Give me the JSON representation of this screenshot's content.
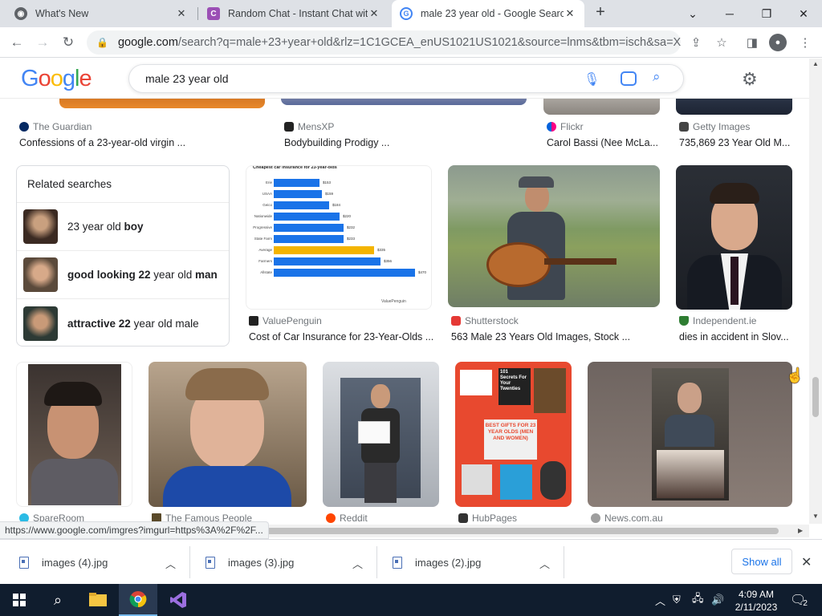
{
  "browser": {
    "tabs": [
      {
        "title": "What's New",
        "icon": "chrome-icon"
      },
      {
        "title": "Random Chat - Instant Chat with",
        "icon": "c-icon"
      },
      {
        "title": "male 23 year old - Google Searc",
        "icon": "google-icon"
      }
    ],
    "url_main": "google.com",
    "url_rest": "/search?q=male+23+year+old&rlz=1C1GCEA_enUS1021US1021&source=lnms&tbm=isch&sa=X&v..."
  },
  "google": {
    "logo": [
      "G",
      "o",
      "o",
      "g",
      "l",
      "e"
    ],
    "query": "male 23 year old"
  },
  "top_results": [
    {
      "source": "The Guardian",
      "caption": "Confessions of a 23-year-old virgin ..."
    },
    {
      "source": "MensXP",
      "caption": "Bodybuilding Prodigy ..."
    },
    {
      "source": "Flickr",
      "caption": "Carol Bassi (Nee McLa..."
    },
    {
      "source": "Getty Images",
      "caption": "735,869 23 Year Old M..."
    }
  ],
  "related": {
    "title": "Related searches",
    "items": [
      {
        "pre": "23 year old ",
        "b1": "boy",
        "mid": "",
        "b2": ""
      },
      {
        "pre": "",
        "b1": "good looking 22",
        "mid": " year old ",
        "b2": "man"
      },
      {
        "pre": "",
        "b1": "attractive 22",
        "mid": " year old male",
        "b2": ""
      }
    ]
  },
  "row2": [
    {
      "source": "ValuePenguin",
      "caption": "Cost of Car Insurance for 23-Year-Olds ..."
    },
    {
      "source": "Shutterstock",
      "caption": "563 Male 23 Years Old Images, Stock ..."
    },
    {
      "source": "Independent.ie",
      "caption": "dies in accident in Slov..."
    }
  ],
  "chart_thumb": {
    "title": "Cheapest car insurance for 23-year-olds",
    "rows": [
      {
        "label": "Erie",
        "value": "$153"
      },
      {
        "label": "USAA",
        "value": "$159"
      },
      {
        "label": "Geico",
        "value": "$184"
      },
      {
        "label": "Nationwide",
        "value": "$220"
      },
      {
        "label": "Progressive",
        "value": "$232"
      },
      {
        "label": "State Farm",
        "value": "$233"
      },
      {
        "label": "Average",
        "value": "$335"
      },
      {
        "label": "Farmers",
        "value": "$356"
      },
      {
        "label": "Allstate",
        "value": "$470"
      }
    ],
    "footer": "ValuePenguin"
  },
  "gift_thumb": {
    "book1": "101",
    "book2": "Secrets For Your Twenties",
    "sign": "BEST GIFTS FOR 23 YEAR OLDS (MEN AND WOMEN)"
  },
  "row3": [
    {
      "source": "SpareRoom"
    },
    {
      "source": "The Famous People"
    },
    {
      "source": "Reddit"
    },
    {
      "source": "HubPages"
    },
    {
      "source": "News.com.au"
    }
  ],
  "status_url": "https://www.google.com/imgres?imgurl=https%3A%2F%2F...",
  "downloads": {
    "items": [
      "images (4).jpg",
      "images (3).jpg",
      "images (2).jpg"
    ],
    "show_all": "Show all"
  },
  "clock": {
    "time": "4:09 AM",
    "date": "2/11/2023"
  },
  "notif_count": "2"
}
